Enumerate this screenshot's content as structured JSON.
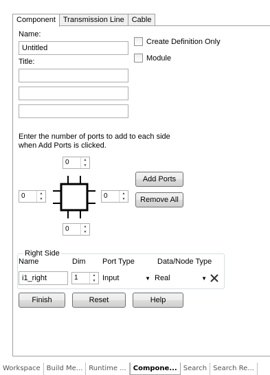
{
  "tabs": [
    {
      "label": "Component",
      "active": true
    },
    {
      "label": "Transmission Line",
      "active": false
    },
    {
      "label": "Cable",
      "active": false
    }
  ],
  "form": {
    "name_label": "Name:",
    "name_value": "Untitled",
    "title_label": "Title:",
    "create_definition_only": "Create Definition Only",
    "module": "Module",
    "ports_instruction_line1": "Enter the number of ports to add to each side",
    "ports_instruction_line2": "when Add Ports is clicked.",
    "ports": {
      "top": "0",
      "left": "0",
      "right": "0",
      "bottom": "0"
    },
    "add_ports": "Add Ports",
    "remove_all": "Remove All"
  },
  "right_side": {
    "group_title": "Right Side",
    "col_name": "Name",
    "col_dim": "Dim",
    "col_port_type": "Port Type",
    "col_data_type": "Data/Node Type",
    "name_value": "i1_right",
    "dim_value": "1",
    "port_type_value": "Input",
    "data_type_value": "Real"
  },
  "buttons": {
    "finish": "Finish",
    "reset": "Reset",
    "help": "Help"
  },
  "bottom_tabs": [
    {
      "label": "Workspace",
      "active": false
    },
    {
      "label": "Build Me...",
      "active": false
    },
    {
      "label": "Runtime ...",
      "active": false
    },
    {
      "label": "Compone...",
      "active": true
    },
    {
      "label": "Search",
      "active": false
    },
    {
      "label": "Search Re...",
      "active": false
    }
  ],
  "colors": {
    "panel_border": "#a0a0a0",
    "button_border": "#707070"
  }
}
